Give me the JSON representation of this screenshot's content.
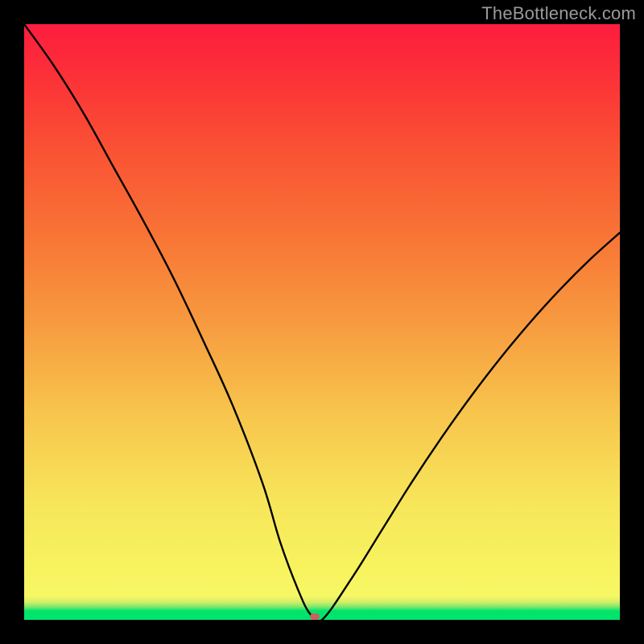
{
  "watermark": "TheBottleneck.com",
  "chart_data": {
    "type": "line",
    "title": "",
    "xlabel": "",
    "ylabel": "",
    "xlim": [
      0,
      100
    ],
    "ylim": [
      0,
      100
    ],
    "series": [
      {
        "name": "curve",
        "x": [
          0,
          5,
          10,
          15,
          20,
          25,
          30,
          35,
          40,
          43,
          46,
          48,
          50,
          55,
          60,
          65,
          70,
          75,
          80,
          85,
          90,
          95,
          100
        ],
        "values": [
          100,
          93,
          85,
          76,
          67,
          57.5,
          47,
          36,
          23,
          13,
          5,
          1,
          0,
          7,
          15,
          23,
          30.5,
          37.5,
          44,
          50,
          55.5,
          60.5,
          65
        ]
      }
    ],
    "marker": {
      "x": 48.8,
      "y": 0.5,
      "color": "#c9615e"
    },
    "gradient_bg": {
      "stops": [
        {
          "pos": 0.0,
          "color": "#00e46c"
        },
        {
          "pos": 0.03,
          "color": "#f7f765"
        },
        {
          "pos": 0.5,
          "color": "#f79a3f"
        },
        {
          "pos": 1.0,
          "color": "#fd1d3e"
        }
      ]
    }
  }
}
